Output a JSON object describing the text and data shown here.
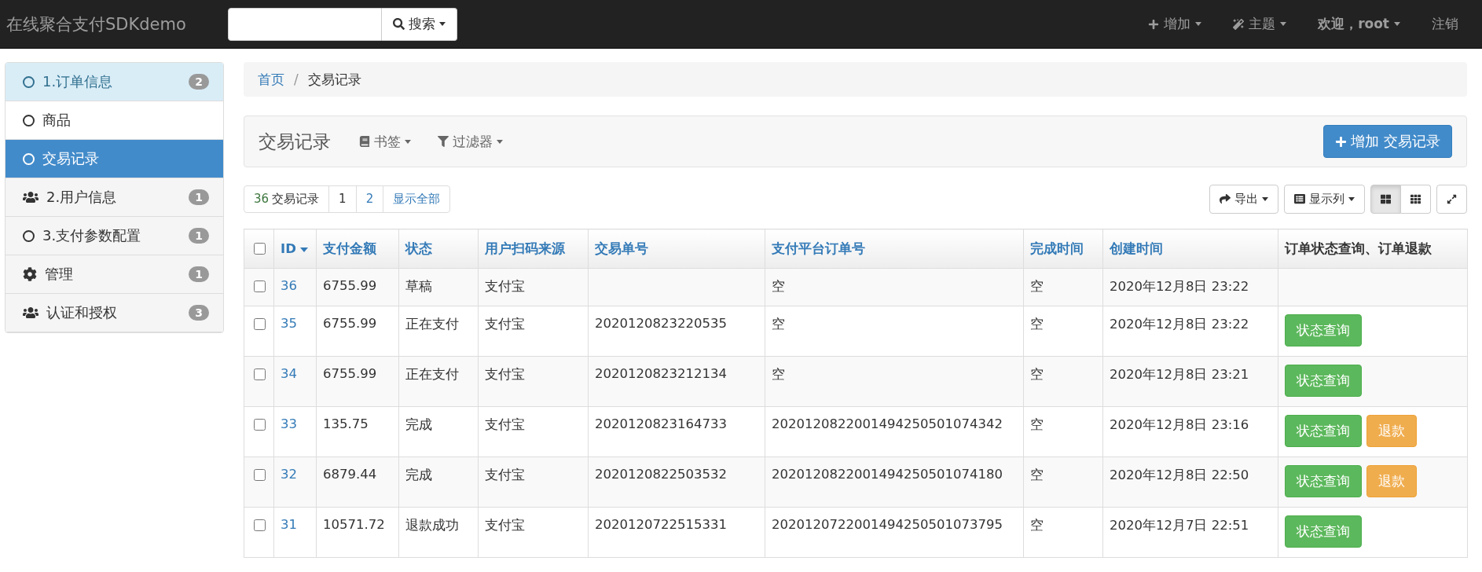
{
  "navbar": {
    "brand": "在线聚合支付SDKdemo",
    "search_button": "搜索",
    "menus": [
      "增加",
      "主题",
      "欢迎，root",
      "注销"
    ]
  },
  "sidebar": {
    "groups": [
      {
        "label": "1.订单信息",
        "badge": "2",
        "expanded": true,
        "children": [
          {
            "label": "商品",
            "selected": false
          },
          {
            "label": "交易记录",
            "selected": true
          }
        ]
      },
      {
        "label": "2.用户信息",
        "badge": "1",
        "expanded": false
      },
      {
        "label": "3.支付参数配置",
        "badge": "1",
        "expanded": false
      },
      {
        "label": "管理",
        "badge": "1",
        "expanded": false
      },
      {
        "label": "认证和授权",
        "badge": "3",
        "expanded": false
      }
    ]
  },
  "breadcrumb": {
    "items": [
      "首页",
      "交易记录"
    ],
    "separator": "/"
  },
  "panel": {
    "title": "交易记录",
    "bookmarks": "书签",
    "filters": "过滤器",
    "add_button": "增加 交易记录"
  },
  "pagination": {
    "count": "36",
    "count_label": "交易记录",
    "pages": [
      {
        "label": "1",
        "selected": true
      },
      {
        "label": "2",
        "selected": false
      }
    ],
    "show_all": "显示全部"
  },
  "tools": {
    "export": "导出",
    "columns": "显示列",
    "views": [
      {
        "selected": true
      },
      {
        "selected": false
      }
    ]
  },
  "table": {
    "select_all_checked": false,
    "columns": [
      {
        "label": "ID",
        "sorted": true
      },
      {
        "label": "支付金额",
        "sorted": false
      },
      {
        "label": "状态",
        "sorted": false
      },
      {
        "label": "用户扫码来源",
        "sorted": false
      },
      {
        "label": "交易单号",
        "sorted": false
      },
      {
        "label": "支付平台订单号",
        "sorted": false
      },
      {
        "label": "完成时间",
        "sorted": false
      },
      {
        "label": "创建时间",
        "sorted": false
      },
      {
        "label": "订单状态查询、订单退款",
        "sorted": false
      }
    ],
    "rows": [
      {
        "checked": false,
        "id": "36",
        "amount": "6755.99",
        "status": "草稿",
        "source": "支付宝",
        "trade_no": "",
        "platform_no": "空",
        "finished": "空",
        "created": "2020年12月8日 23:22",
        "actions": []
      },
      {
        "checked": false,
        "id": "35",
        "amount": "6755.99",
        "status": "正在支付",
        "source": "支付宝",
        "trade_no": "2020120823220535",
        "platform_no": "空",
        "finished": "空",
        "created": "2020年12月8日 23:22",
        "actions": [
          {
            "kind": "query",
            "label": "状态查询"
          }
        ]
      },
      {
        "checked": false,
        "id": "34",
        "amount": "6755.99",
        "status": "正在支付",
        "source": "支付宝",
        "trade_no": "2020120823212134",
        "platform_no": "空",
        "finished": "空",
        "created": "2020年12月8日 23:21",
        "actions": [
          {
            "kind": "query",
            "label": "状态查询"
          }
        ]
      },
      {
        "checked": false,
        "id": "33",
        "amount": "135.75",
        "status": "完成",
        "source": "支付宝",
        "trade_no": "2020120823164733",
        "platform_no": "2020120822001494250501074342",
        "finished": "空",
        "created": "2020年12月8日 23:16",
        "actions": [
          {
            "kind": "query",
            "label": "状态查询"
          },
          {
            "kind": "refund",
            "label": "退款"
          }
        ]
      },
      {
        "checked": false,
        "id": "32",
        "amount": "6879.44",
        "status": "完成",
        "source": "支付宝",
        "trade_no": "2020120822503532",
        "platform_no": "2020120822001494250501074180",
        "finished": "空",
        "created": "2020年12月8日 22:50",
        "actions": [
          {
            "kind": "query",
            "label": "状态查询"
          },
          {
            "kind": "refund",
            "label": "退款"
          }
        ]
      },
      {
        "checked": false,
        "id": "31",
        "amount": "10571.72",
        "status": "退款成功",
        "source": "支付宝",
        "trade_no": "2020120722515331",
        "platform_no": "2020120722001494250501073795",
        "finished": "空",
        "created": "2020年12月7日 22:51",
        "actions": [
          {
            "kind": "query",
            "label": "状态查询"
          }
        ]
      }
    ]
  }
}
